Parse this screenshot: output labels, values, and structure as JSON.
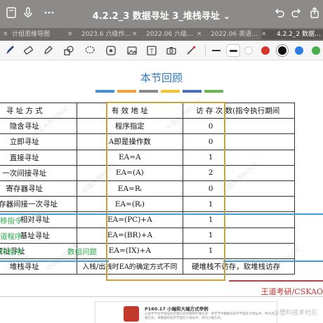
{
  "window": {
    "title": "4.2.2_3 数据寻址 3_堆栈寻址"
  },
  "tabs": [
    {
      "label": "计组思维导图",
      "active": false
    },
    {
      "label": "2023.6 六级作…",
      "active": false
    },
    {
      "label": "2022.06 六级…",
      "active": false
    },
    {
      "label": "2022.06 英语…",
      "active": false
    },
    {
      "label": "4.2.2_2 数据…",
      "active": true
    }
  ],
  "toolbar": {
    "colors": [
      "#d7372b",
      "#111111",
      "#2f7de1",
      "#46b04a"
    ],
    "tools": [
      "pen-icon",
      "eraser-icon",
      "highlighter-icon",
      "shapes-icon",
      "lasso-icon",
      "sticker-icon",
      "image-icon",
      "text-icon",
      "camera-icon",
      "laser-icon"
    ]
  },
  "doc": {
    "heading": "本节回顾",
    "accent_bars": [
      "#4a8fd0",
      "#f2a23a",
      "#8a8a8a",
      "#f4c430",
      "#4a72b8",
      "#6bb552"
    ],
    "table": {
      "header": [
        "寻 址 方 式",
        "有 效 地 址",
        "访 存 次 数(指令执行期间"
      ],
      "rows": [
        [
          "隐含寻址",
          "程序指定",
          "0"
        ],
        [
          "立即寻址",
          "A即是操作数",
          "0"
        ],
        [
          "直接寻址",
          "EA=A",
          "1"
        ],
        [
          "一次间接寻址",
          "EA=(A)",
          "2"
        ],
        [
          "寄存器寻址",
          "EA=Rᵢ",
          "0"
        ],
        [
          "寄存器间接一次寻址",
          "EA=(Rᵢ)",
          "1"
        ],
        [
          "相对寻址",
          "EA=(PC)+A",
          "1"
        ],
        [
          "基址寻址",
          "EA=(BR)+A",
          "1"
        ],
        [
          "变址寻址",
          "EA=(IX)+A",
          "1"
        ],
        [
          "堆栈寻址",
          "入栈/出栈时EA的确定方式不同",
          "硬堆栈不访存，软堆栈访存"
        ]
      ]
    },
    "notes": {
      "relative": "移指令",
      "base": "道程序",
      "index": "环程序",
      "array": "数组问题"
    },
    "footer": "王道考研/CSKAO",
    "watermark": "中国大学MOOC",
    "card": {
      "title": "P160.17 小端和大端方式举例",
      "text": "以很字节为字地址的存储方式有两种存储方式：将字节中数据的低字节放在大地址中，称为大端方式；将数据的低字节放在小地址中，称为小端方式。",
      "source": "@塑料技术社区"
    }
  }
}
